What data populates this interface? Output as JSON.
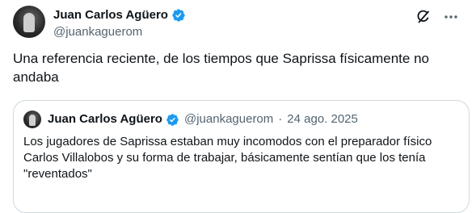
{
  "tweet": {
    "author": {
      "display_name": "Juan Carlos Agüero",
      "handle": "@juankaguerom"
    },
    "text": "Una referencia reciente, de los tiempos que Saprissa físicamente no andaba"
  },
  "quoted_tweet": {
    "author": {
      "display_name": "Juan Carlos Agüero",
      "handle": "@juankaguerom"
    },
    "separator": "·",
    "date": "24 ago. 2025",
    "text": "Los jugadores de Saprissa estaban muy incomodos con el preparador físico Carlos Villalobos y su forma de trabajar, básicamente sentían que los tenía \"reventados\""
  },
  "icons": {
    "verified": "verified-badge-icon",
    "grok": "grok-icon",
    "more": "more-options-icon"
  },
  "colors": {
    "verified": "#1d9bf0",
    "secondary_text": "#536471",
    "border": "#cfd9de"
  }
}
